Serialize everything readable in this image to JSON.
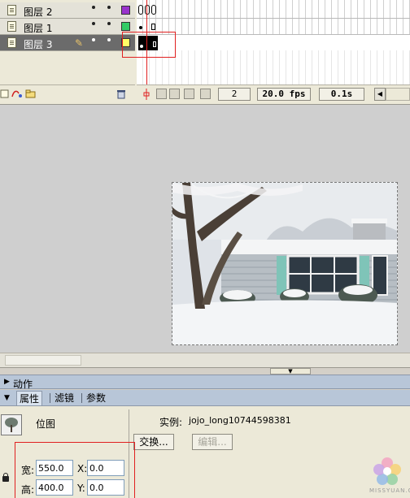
{
  "timeline": {
    "layers": [
      {
        "name": "图层 2",
        "color": "#9933cc",
        "selected": false,
        "editing": false
      },
      {
        "name": "图层 1",
        "color": "#33cc66",
        "selected": false,
        "editing": false
      },
      {
        "name": "图层 3",
        "color": "#ffff66",
        "selected": true,
        "editing": true
      }
    ],
    "current_frame": "2",
    "frame_rate": "20.0 fps",
    "elapsed_time": "0.1s"
  },
  "stage": {
    "image_subject": "snow-covered-house-photo"
  },
  "panels": {
    "actions_label": "动作",
    "tabs": [
      "属性",
      "滤镜",
      "参数"
    ],
    "active_tab": "属性"
  },
  "properties": {
    "type_label": "位图",
    "instance_label": "实例:",
    "instance_name": "jojo_long10744598381",
    "swap_button": "交换...",
    "edit_button": "编辑...",
    "width_label": "宽:",
    "width_value": "550.0",
    "height_label": "高:",
    "height_value": "400.0",
    "x_label": "X:",
    "x_value": "0.0",
    "y_label": "Y:",
    "y_value": "0.0"
  },
  "watermark": {
    "text": "MISSYUAN.COM"
  },
  "colors": {
    "accent_red": "#e02020",
    "panel_header": "#b8c6d8"
  }
}
